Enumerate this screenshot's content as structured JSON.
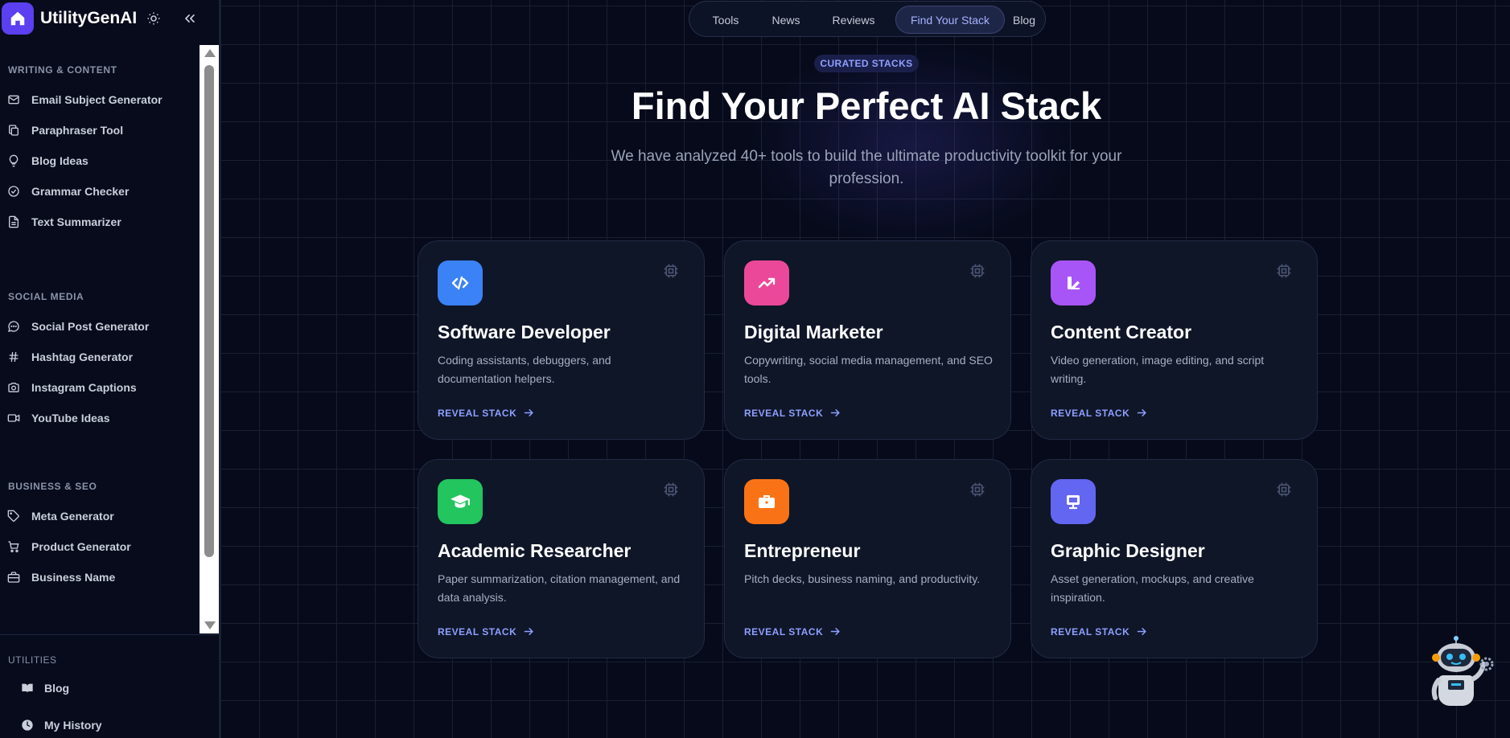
{
  "brand": {
    "name": "UtilityGenAI"
  },
  "sidebar": {
    "sections": [
      {
        "title": "WRITING & CONTENT",
        "items": [
          {
            "label": "Email Subject Generator",
            "icon": "mail-icon"
          },
          {
            "label": "Paraphraser Tool",
            "icon": "copy-icon"
          },
          {
            "label": "Blog Ideas",
            "icon": "lightbulb-icon"
          },
          {
            "label": "Grammar Checker",
            "icon": "check-circle-icon"
          },
          {
            "label": "Text Summarizer",
            "icon": "file-text-icon"
          }
        ]
      },
      {
        "title": "SOCIAL MEDIA",
        "items": [
          {
            "label": "Social Post Generator",
            "icon": "message-circle-icon"
          },
          {
            "label": "Hashtag Generator",
            "icon": "hash-icon"
          },
          {
            "label": "Instagram Captions",
            "icon": "camera-icon"
          },
          {
            "label": "YouTube Ideas",
            "icon": "video-icon"
          }
        ]
      },
      {
        "title": "BUSINESS & SEO",
        "items": [
          {
            "label": "Meta Generator",
            "icon": "tag-icon"
          },
          {
            "label": "Product Generator",
            "icon": "cart-icon"
          },
          {
            "label": "Business Name",
            "icon": "briefcase-icon"
          }
        ]
      }
    ],
    "utilities": {
      "title": "UTILITIES",
      "items": [
        {
          "label": "Blog",
          "icon": "book-open-icon"
        },
        {
          "label": "My History",
          "icon": "clock-icon"
        }
      ]
    }
  },
  "topnav": {
    "items": [
      {
        "label": "Tools"
      },
      {
        "label": "News"
      },
      {
        "label": "Reviews"
      },
      {
        "label": "Find Your Stack",
        "active": true
      },
      {
        "label": "Blog"
      }
    ]
  },
  "hero": {
    "eyebrow": "CURATED STACKS",
    "title": "Find Your Perfect AI Stack",
    "subtitle": "We have analyzed 40+ tools to build the ultimate productivity toolkit for your profession."
  },
  "cards": [
    {
      "title": "Software Developer",
      "description": "Coding assistants, debuggers, and documentation helpers.",
      "cta": "REVEAL STACK",
      "icon": "code-icon",
      "color": "#3b82f6"
    },
    {
      "title": "Digital Marketer",
      "description": "Copywriting, social media management, and SEO tools.",
      "cta": "REVEAL STACK",
      "icon": "trending-up-icon",
      "color": "#ec4899"
    },
    {
      "title": "Content Creator",
      "description": "Video generation, image editing, and script writing.",
      "cta": "REVEAL STACK",
      "icon": "pen-tool-icon",
      "color": "#a855f7"
    },
    {
      "title": "Academic Researcher",
      "description": "Paper summarization, citation management, and data analysis.",
      "cta": "REVEAL STACK",
      "icon": "graduation-cap-icon",
      "color": "#22c55e"
    },
    {
      "title": "Entrepreneur",
      "description": "Pitch decks, business naming, and productivity.",
      "cta": "REVEAL STACK",
      "icon": "briefcase-icon",
      "color": "#f97316"
    },
    {
      "title": "Graphic Designer",
      "description": "Asset generation, mockups, and creative inspiration.",
      "cta": "REVEAL STACK",
      "icon": "monitor-icon",
      "color": "#6366f1"
    }
  ],
  "assistant": {
    "icon": "robot-assistant-icon"
  }
}
